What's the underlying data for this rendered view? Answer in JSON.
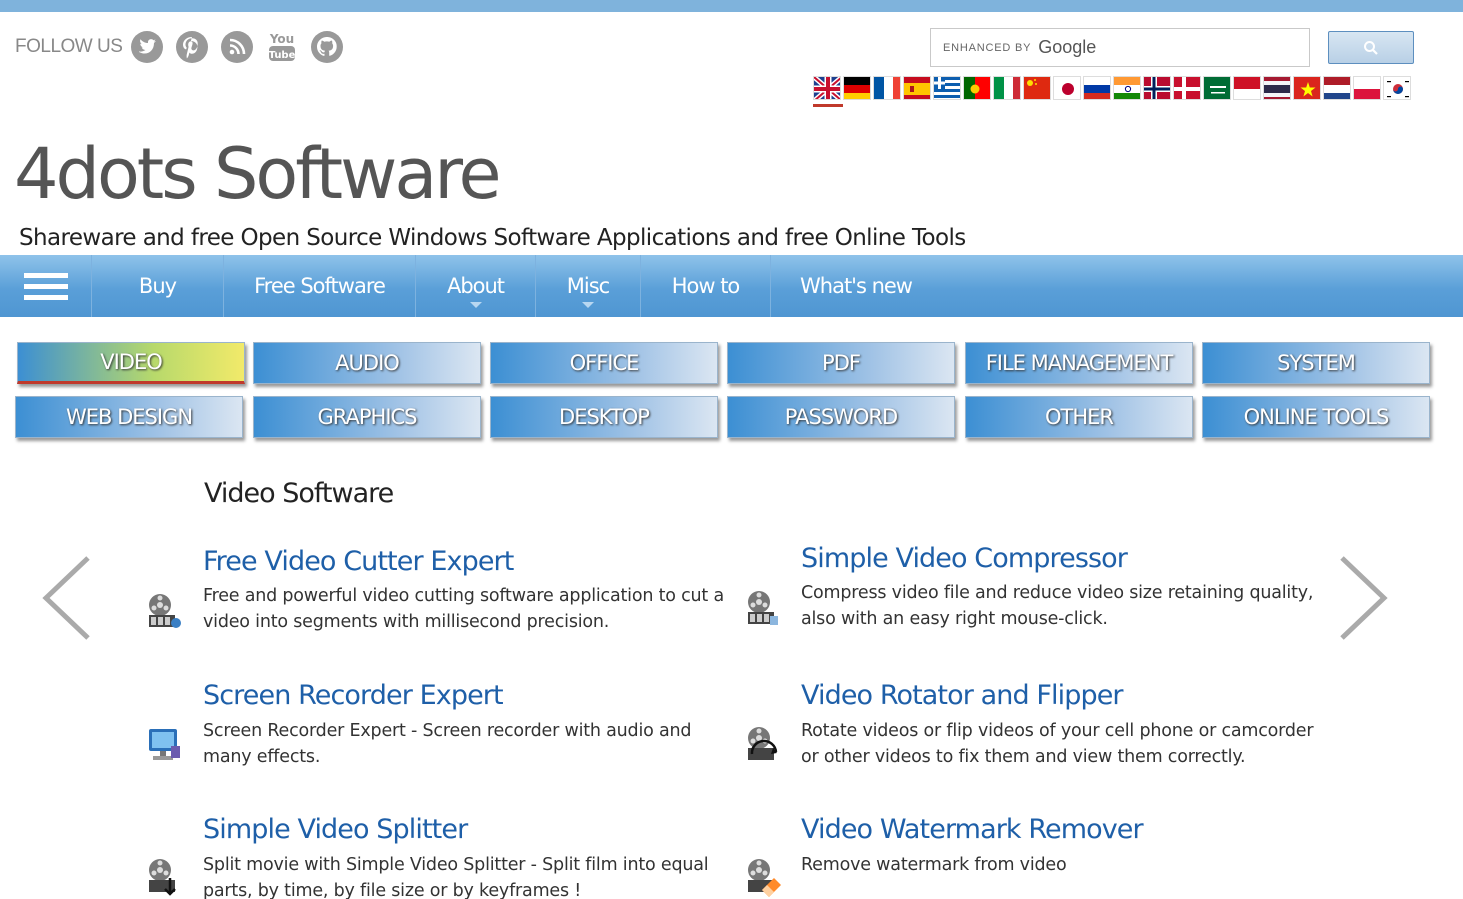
{
  "follow": {
    "label": "FOLLOW US",
    "icons": [
      "twitter-icon",
      "pinterest-icon",
      "rss-icon",
      "youtube-icon",
      "github-icon"
    ]
  },
  "search": {
    "enhanced_by": "ENHANCED BY",
    "google": "Google",
    "placeholder": "",
    "button_icon": "search-icon"
  },
  "languages": [
    "English",
    "German",
    "French",
    "Spanish",
    "Greek",
    "Portuguese",
    "Italian",
    "Chinese",
    "Japanese",
    "Russian",
    "Hindi",
    "Norwegian",
    "Danish",
    "Arabic",
    "Indonesian",
    "Thai",
    "Vietnamese",
    "Dutch",
    "Polish",
    "Korean"
  ],
  "site": {
    "title": "4dots Software",
    "tagline": "Shareware and free Open Source Windows Software Applications and free Online Tools"
  },
  "nav": {
    "items": [
      "Buy",
      "Free Software",
      "About",
      "Misc",
      "How to",
      "What's new"
    ]
  },
  "categories": [
    "VIDEO",
    "AUDIO",
    "OFFICE",
    "PDF",
    "FILE MANAGEMENT",
    "SYSTEM",
    "WEB DESIGN",
    "GRAPHICS",
    "DESKTOP",
    "PASSWORD",
    "OTHER",
    "ONLINE TOOLS"
  ],
  "main": {
    "section_title": "Video Software",
    "products": [
      {
        "title": "Free Video Cutter Expert",
        "desc": "Free and powerful video cutting software application to cut a video into segments with millisecond precision."
      },
      {
        "title": "Simple Video Compressor",
        "desc": "Compress video file and reduce video size retaining quality, also with an easy right mouse-click."
      },
      {
        "title": "Screen Recorder Expert",
        "desc": "Screen Recorder Expert - Screen recorder with audio and many effects."
      },
      {
        "title": "Video Rotator and Flipper",
        "desc": "Rotate videos or flip videos of your cell phone or camcorder or other videos to fix them and view them correctly."
      },
      {
        "title": "Simple Video Splitter",
        "desc": "Split movie with Simple Video Splitter - Split film into equal parts, by time, by file size or by keyframes !"
      },
      {
        "title": "Video Watermark Remover",
        "desc": "Remove watermark from video"
      }
    ]
  },
  "colors": {
    "nav_blue": "#5a9fd8",
    "link_blue": "#1e5fa8",
    "accent_red": "#c0392b"
  }
}
